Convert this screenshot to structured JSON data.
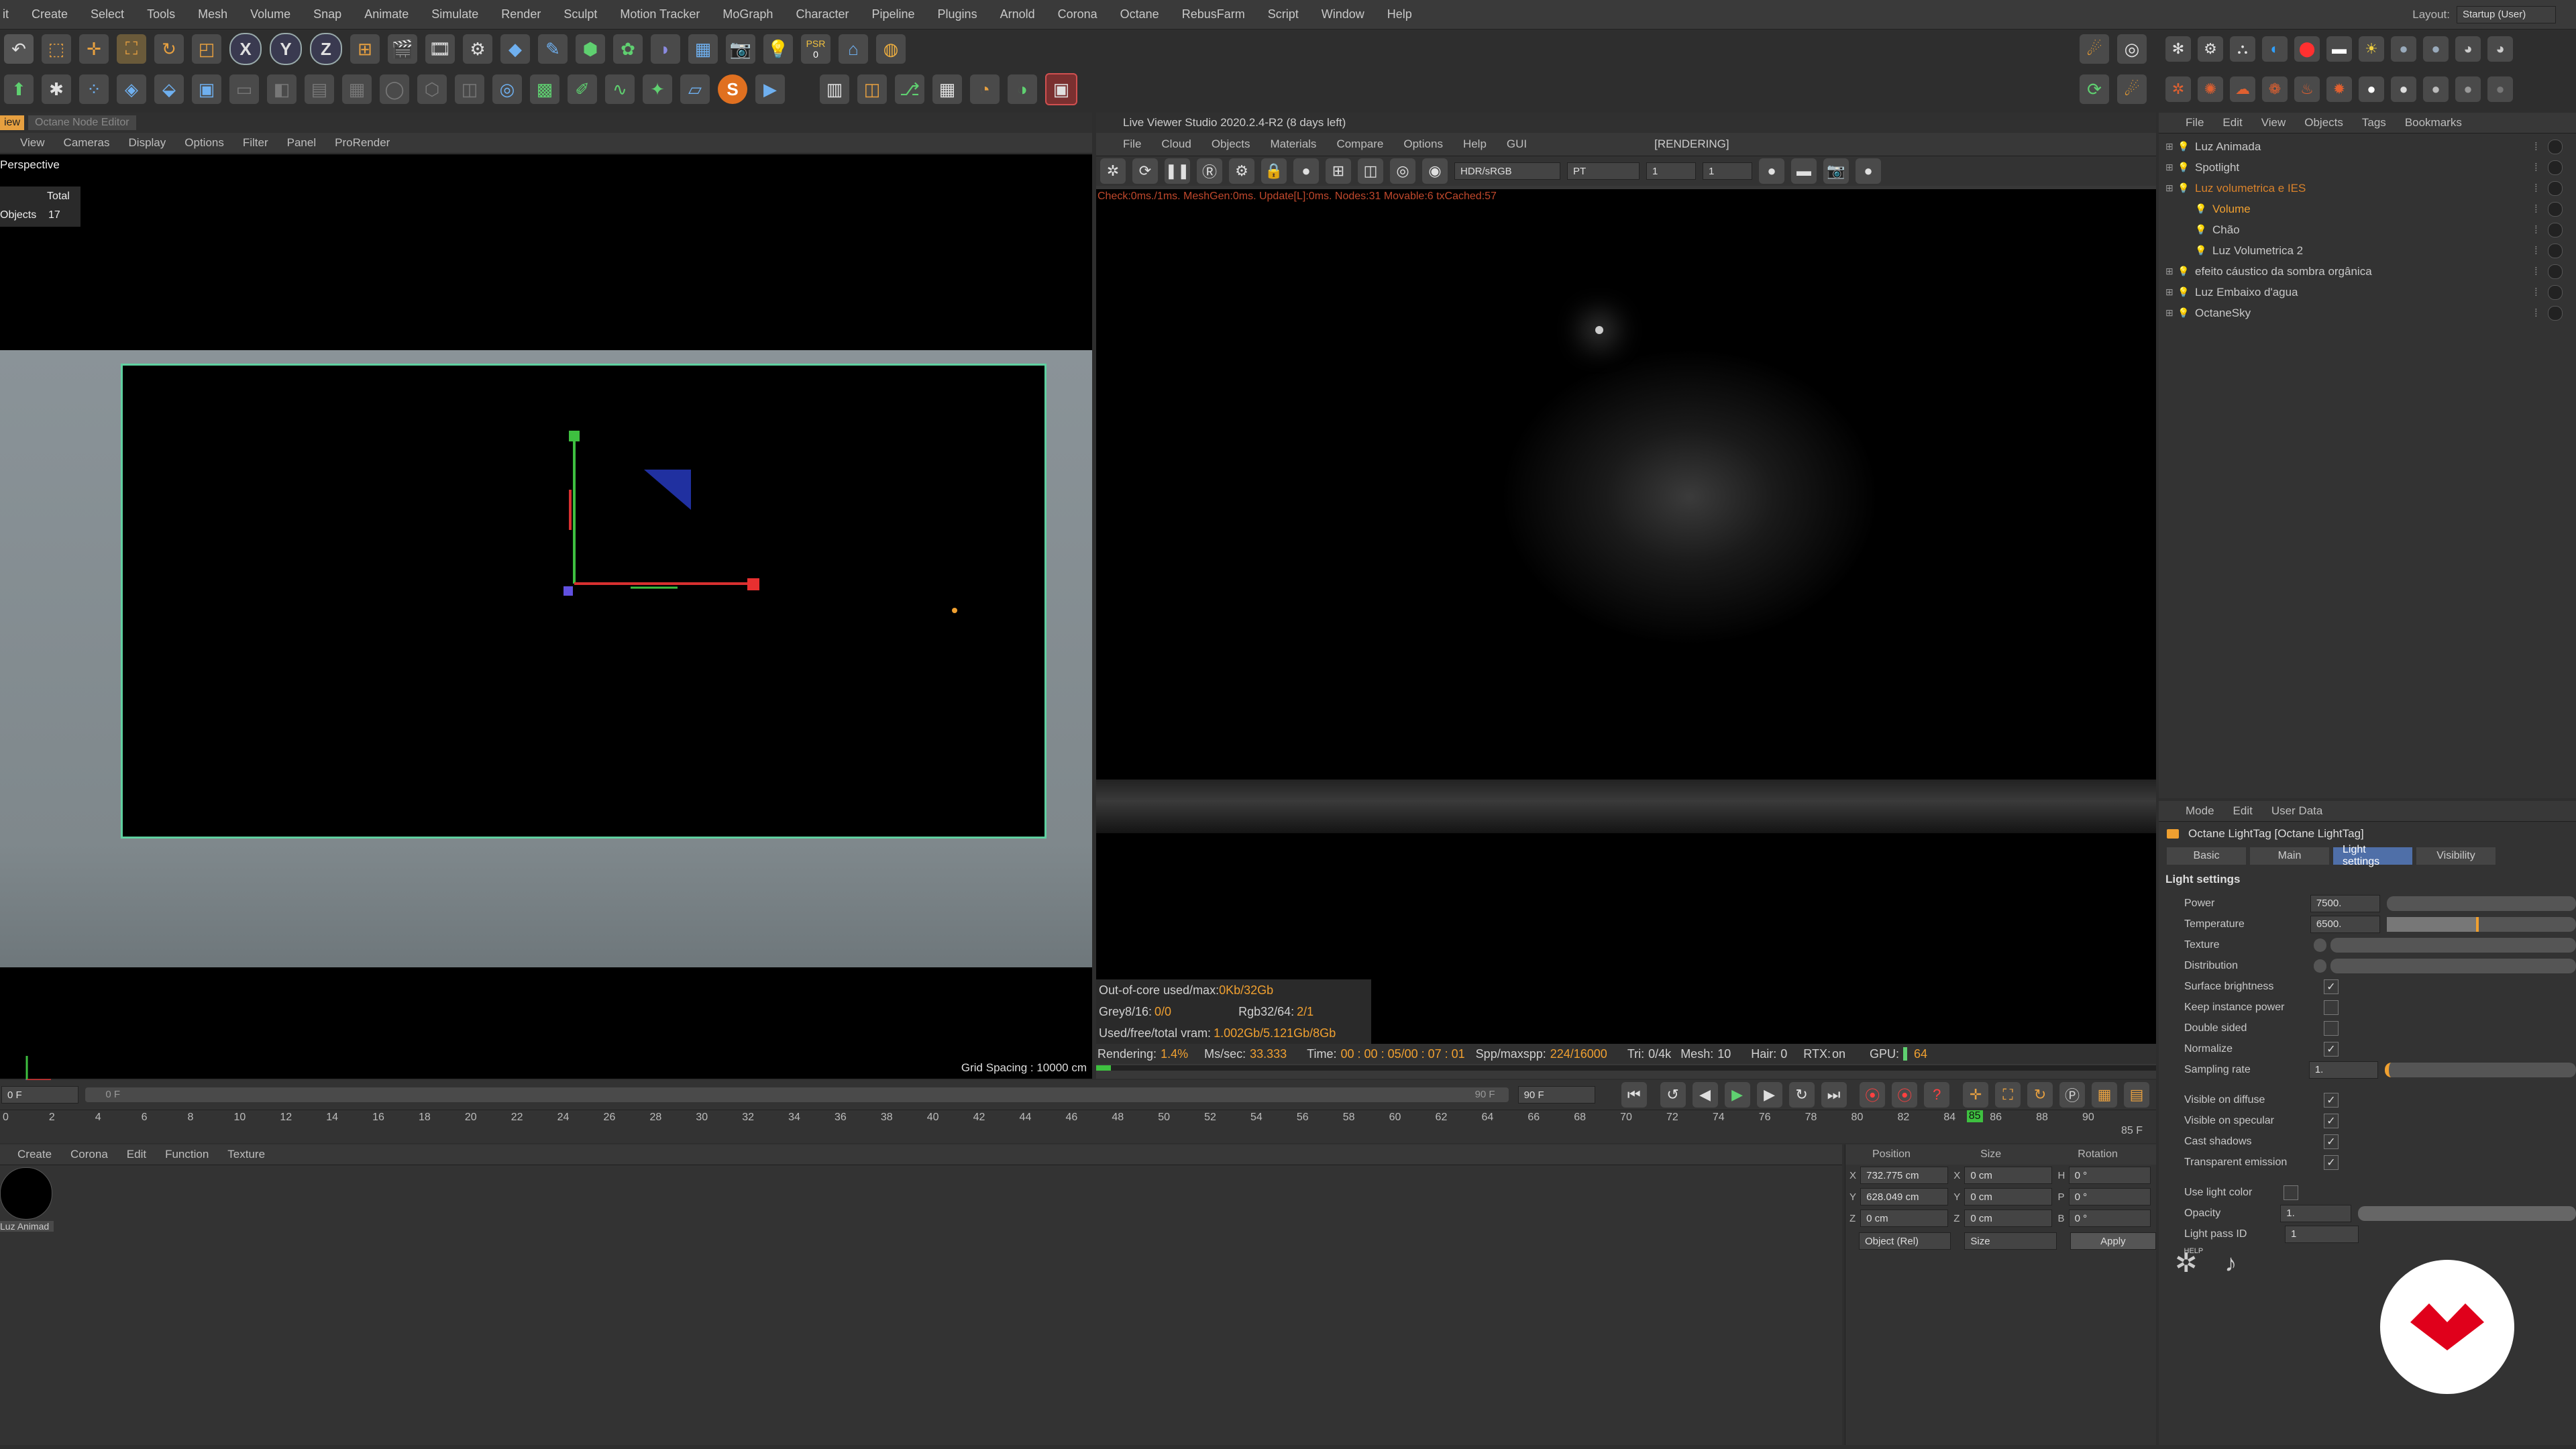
{
  "menu": {
    "items": [
      "it",
      "Create",
      "Select",
      "Tools",
      "Mesh",
      "Volume",
      "Snap",
      "Animate",
      "Simulate",
      "Render",
      "Sculpt",
      "Motion Tracker",
      "MoGraph",
      "Character",
      "Pipeline",
      "Plugins",
      "Arnold",
      "Corona",
      "Octane",
      "RebusFarm",
      "Script",
      "Window",
      "Help"
    ],
    "layout_label": "Layout:",
    "layout_value": "Startup (User)"
  },
  "toolbar": {
    "axis_x": "X",
    "axis_y": "Y",
    "axis_z": "Z",
    "psr_label": "PSR",
    "psr_value": "0"
  },
  "left_panel": {
    "tabs": [
      "iew",
      "Octane Node Editor"
    ],
    "menu": [
      "View",
      "Cameras",
      "Display",
      "Options",
      "Filter",
      "Panel",
      "ProRender"
    ],
    "viewport_name": "Perspective",
    "hud_total": "Total",
    "hud_objects_label": "Objects",
    "hud_objects_value": "17",
    "grid_spacing": "Grid Spacing : 10000 cm"
  },
  "live_viewer": {
    "title": "Live Viewer Studio 2020.2.4-R2 (8 days left)",
    "menu": [
      "File",
      "Cloud",
      "Objects",
      "Materials",
      "Compare",
      "Options",
      "Help",
      "GUI"
    ],
    "status": "[RENDERING]",
    "color_mode": "HDR/sRGB",
    "kernel": "PT",
    "spin1": "1",
    "spin2": "1",
    "check_line": "Check:0ms./1ms. MeshGen:0ms. Update[L]:0ms. Nodes:31 Movable:6 txCached:57",
    "outofcore_label": "Out-of-core used/max:",
    "outofcore_value": "0Kb/32Gb",
    "grey_label": "Grey8/16:",
    "grey_value": "0/0",
    "rgb_label": "Rgb32/64:",
    "rgb_value": "2/1",
    "vram_label": "Used/free/total vram:",
    "vram_value": "1.002Gb/5.121Gb/8Gb",
    "rendering_label": "Rendering:",
    "rendering_value": "1.4%",
    "ms_label": "Ms/sec:",
    "ms_value": "33.333",
    "time_label": "Time:",
    "time_value": "00 : 00 : 05/00 : 07 : 01",
    "spp_label": "Spp/maxspp:",
    "spp_value": "224/16000",
    "tri_label": "Tri:",
    "tri_value": "0/4k",
    "mesh_label": "Mesh:",
    "mesh_value": "10",
    "hair_label": "Hair:",
    "hair_value": "0",
    "rtx_label": "RTX:",
    "rtx_value": "on",
    "gpu_label": "GPU:",
    "gpu_value": "64",
    "progress": 0.014
  },
  "object_manager": {
    "menu": [
      "File",
      "Edit",
      "View",
      "Objects",
      "Tags",
      "Bookmarks"
    ],
    "objects": [
      {
        "name": "Luz Animada",
        "indent": 0,
        "color": "#c8c8c8"
      },
      {
        "name": "Spotlight",
        "indent": 0,
        "color": "#c8c8c8"
      },
      {
        "name": "Luz volumetrica e IES",
        "indent": 0,
        "color": "#d9822b"
      },
      {
        "name": "Volume",
        "indent": 1,
        "color": "#f0a030"
      },
      {
        "name": "Chão",
        "indent": 1,
        "color": "#c8c8c8"
      },
      {
        "name": "Luz Volumetrica 2",
        "indent": 1,
        "color": "#c8c8c8"
      },
      {
        "name": "efeito cáustico da sombra orgânica",
        "indent": 0,
        "color": "#c8c8c8"
      },
      {
        "name": "Luz Embaixo d'agua",
        "indent": 0,
        "color": "#c8c8c8"
      },
      {
        "name": "OctaneSky",
        "indent": 0,
        "color": "#c8c8c8"
      }
    ]
  },
  "attributes": {
    "menu": [
      "Mode",
      "Edit",
      "User Data"
    ],
    "title": "Octane LightTag [Octane LightTag]",
    "tabs": [
      "Basic",
      "Main",
      "Light settings",
      "Visibility"
    ],
    "section": "Light settings",
    "power_label": "Power",
    "power_value": "7500.",
    "power_level": 0.0,
    "temperature_label": "Temperature",
    "temperature_value": "6500.",
    "temperature_level": 0.47,
    "texture_label": "Texture",
    "distribution_label": "Distribution",
    "surface_brightness_label": "Surface brightness",
    "surface_brightness_checked": "✓",
    "keep_instance_power_label": "Keep instance power",
    "double_sided_label": "Double sided",
    "normalize_label": "Normalize",
    "normalize_checked": "✓",
    "sampling_rate_label": "Sampling rate",
    "sampling_rate_value": "1.",
    "visible_diffuse_label": "Visible on diffuse",
    "visible_diffuse_checked": "✓",
    "visible_specular_label": "Visible on specular",
    "visible_specular_checked": "✓",
    "cast_shadows_label": "Cast shadows",
    "cast_shadows_checked": "✓",
    "transparent_emission_label": "Transparent emission",
    "transparent_emission_checked": "✓",
    "use_light_color_label": "Use light color",
    "opacity_label": "Opacity",
    "opacity_value": "1.",
    "light_pass_label": "Light pass ID",
    "light_pass_value": "1",
    "help_label": "HELP"
  },
  "timeline": {
    "start_field": "0 F",
    "range_start": "0 F",
    "range_end": "90 F",
    "end_field": "90 F",
    "ticks": [
      "0",
      "2",
      "4",
      "6",
      "8",
      "10",
      "12",
      "14",
      "16",
      "18",
      "20",
      "22",
      "24",
      "26",
      "28",
      "30",
      "32",
      "34",
      "36",
      "38",
      "40",
      "42",
      "44",
      "46",
      "48",
      "50",
      "52",
      "54",
      "56",
      "58",
      "60",
      "62",
      "64",
      "66",
      "68",
      "70",
      "72",
      "74",
      "76",
      "78",
      "80",
      "82",
      "84",
      "86",
      "88",
      "90"
    ],
    "current_frame": "85",
    "current_field": "85 F"
  },
  "material_manager": {
    "menu": [
      "Create",
      "Corona",
      "Edit",
      "Function",
      "Texture"
    ],
    "material_name": "Luz Animad"
  },
  "coordinates": {
    "headers": [
      "Position",
      "Size",
      "Rotation"
    ],
    "rows": [
      {
        "axis": "X",
        "pos": "732.775 cm",
        "saxis": "X",
        "size": "0 cm",
        "raxis": "H",
        "rot": "0 °"
      },
      {
        "axis": "Y",
        "pos": "628.049 cm",
        "saxis": "Y",
        "size": "0 cm",
        "raxis": "P",
        "rot": "0 °"
      },
      {
        "axis": "Z",
        "pos": "0 cm",
        "saxis": "Z",
        "size": "0 cm",
        "raxis": "B",
        "rot": "0 °"
      }
    ],
    "mode_select": "Object (Rel)",
    "size_select": "Size",
    "apply": "Apply"
  },
  "colors": {
    "accent_blue": "#4f6fa8",
    "render_orange": "#d9822b",
    "logo_red": "#e0001b",
    "frame_green": "#5fd0a0"
  }
}
